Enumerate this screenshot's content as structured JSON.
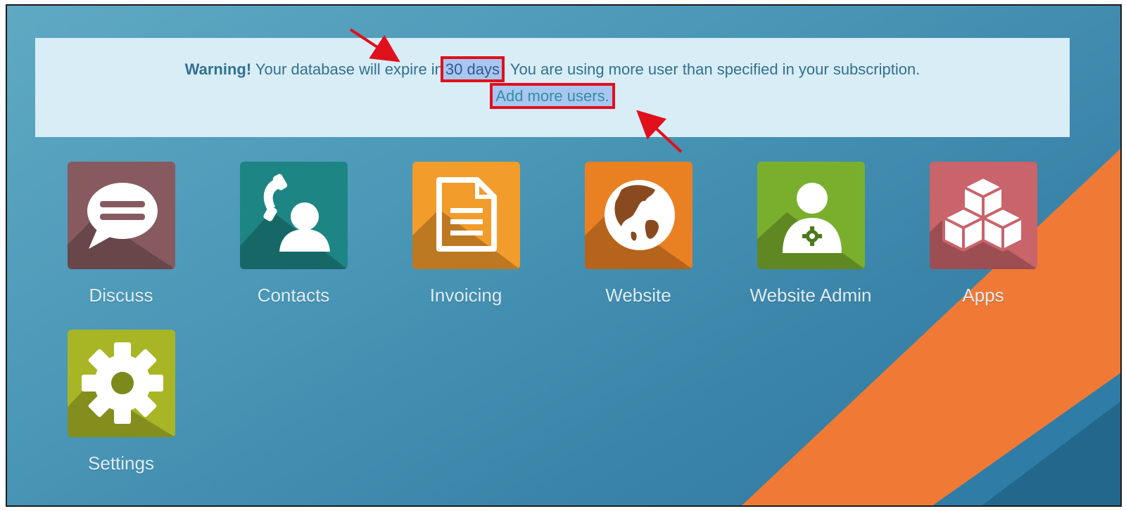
{
  "banner": {
    "warning_label": "Warning!",
    "text_before": "Your database will expire in",
    "highlight_days": "30 days",
    "text_after": ". You are using more user than specified in your subscription.",
    "add_users_link": "Add more users"
  },
  "apps": [
    {
      "label": "Discuss",
      "icon": "speech-bubble-icon",
      "color": "#875a5f"
    },
    {
      "label": "Contacts",
      "icon": "contact-phone-icon",
      "color": "#1d8685"
    },
    {
      "label": "Invoicing",
      "icon": "document-icon",
      "color": "#f19c2b"
    },
    {
      "label": "Website",
      "icon": "globe-icon",
      "color": "#e98123"
    },
    {
      "label": "Website Admin",
      "icon": "user-gear-icon",
      "color": "#7aaf2e"
    },
    {
      "label": "Apps",
      "icon": "cubes-icon",
      "color": "#c8646a"
    },
    {
      "label": "Settings",
      "icon": "gear-icon",
      "color": "#a8b626"
    }
  ],
  "colors": {
    "annotation_red": "#e0101d",
    "banner_bg": "#d9edf7",
    "stripe_orange": "#f07a35"
  }
}
